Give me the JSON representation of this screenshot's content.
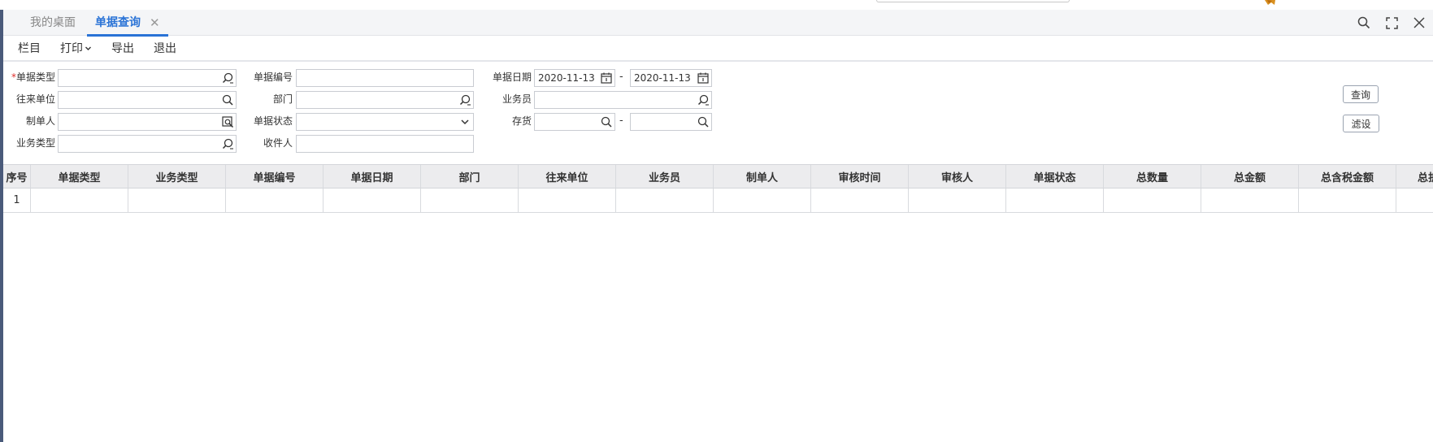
{
  "tabs": [
    {
      "label": "我的桌面",
      "active": false
    },
    {
      "label": "单据查询",
      "active": true
    }
  ],
  "menu": {
    "items": [
      "栏目",
      "打印",
      "导出",
      "退出"
    ]
  },
  "form": {
    "bill_type": {
      "label": "单据类型",
      "required_mark": "*",
      "value": ""
    },
    "bill_no": {
      "label": "单据编号",
      "value": ""
    },
    "bill_date": {
      "label": "单据日期",
      "from": "2020-11-13",
      "to": "2020-11-13",
      "separator": "-"
    },
    "partner": {
      "label": "往来单位",
      "value": ""
    },
    "department": {
      "label": "部门",
      "value": ""
    },
    "salesman": {
      "label": "业务员",
      "value": ""
    },
    "maker": {
      "label": "制单人",
      "value": ""
    },
    "bill_status": {
      "label": "单据状态",
      "value": ""
    },
    "inventory": {
      "label": "存货",
      "from": "",
      "to": "",
      "separator": "-"
    },
    "biz_type": {
      "label": "业务类型",
      "value": ""
    },
    "recipient": {
      "label": "收件人",
      "value": ""
    },
    "query_button": "查询",
    "filter_button": "滤设"
  },
  "grid": {
    "columns": [
      "序号",
      "单据类型",
      "业务类型",
      "单据编号",
      "单据日期",
      "部门",
      "往来单位",
      "业务员",
      "制单人",
      "审核时间",
      "审核人",
      "单据状态",
      "总数量",
      "总金额",
      "总含税金额",
      "总折"
    ],
    "rows": [
      [
        "1",
        "",
        "",
        "",
        "",
        "",
        "",
        "",
        "",
        "",
        "",
        "",
        "",
        "",
        "",
        ""
      ]
    ]
  },
  "colors": {
    "accent": "#2a73d6",
    "required": "#e0302d",
    "left_bar": "#4a5a7a"
  }
}
